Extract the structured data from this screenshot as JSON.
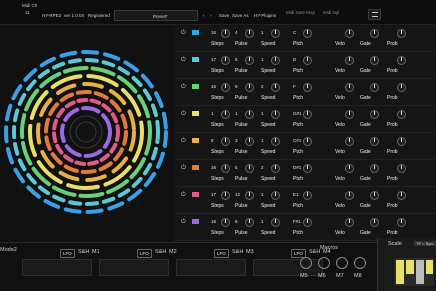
{
  "header": {
    "midi_ch_label": "Midi Ch",
    "midi_ch_value": "11",
    "app_name": "HY-RPE2",
    "version": "ver 1.0.04",
    "registered": "Registered",
    "preset": "Preset*",
    "save": "Save",
    "save_as": "Save As",
    "brand": "HY-Plugins",
    "midi_note_map": "Midi Note Map",
    "midi_ngl": "Midi Ngl",
    "menu_icon": "menu-icon"
  },
  "tracks": [
    {
      "color": "#3aa0e6",
      "steps": "16",
      "pulse": "4",
      "speed": "1",
      "pitch": "C",
      "velo": "",
      "gate": "",
      "prob": ""
    },
    {
      "color": "#5cc8d6",
      "steps": "17",
      "pulse": "8",
      "speed": "1",
      "pitch": "D",
      "velo": "",
      "gate": "",
      "prob": ""
    },
    {
      "color": "#69d07a",
      "steps": "16",
      "pulse": "6",
      "speed": "2",
      "pitch": "F",
      "velo": "",
      "gate": "",
      "prob": ""
    },
    {
      "color": "#e6e06a",
      "steps": "1",
      "pulse": "1",
      "speed": "1",
      "pitch": "G#1",
      "velo": "",
      "gate": "",
      "prob": ""
    },
    {
      "color": "#e6b04a",
      "steps": "8",
      "pulse": "3",
      "speed": "1",
      "pitch": "C#1",
      "velo": "",
      "gate": "",
      "prob": ""
    },
    {
      "color": "#e07a3a",
      "steps": "16",
      "pulse": "5",
      "speed": "2",
      "pitch": "D#1",
      "velo": "",
      "gate": "",
      "prob": ""
    },
    {
      "color": "#e05a8a",
      "steps": "17",
      "pulse": "12",
      "speed": "1",
      "pitch": "E1",
      "velo": "",
      "gate": "",
      "prob": ""
    },
    {
      "color": "#9a6ae6",
      "steps": "16",
      "pulse": "8",
      "speed": "1",
      "pitch": "F#1",
      "velo": "",
      "gate": "",
      "prob": ""
    }
  ],
  "labels": {
    "steps": "Steps",
    "pulse": "Pulse",
    "speed": "Speed",
    "pitch": "Ptch",
    "velo": "Velo",
    "gate": "Gate",
    "prob": "Prob"
  },
  "modulators": [
    {
      "name": "M1",
      "mode": "S&H",
      "lfo": "LFO"
    },
    {
      "name": "M2",
      "mode": "S&H",
      "lfo": "LFO"
    },
    {
      "name": "M3",
      "mode": "S&H",
      "lfo": "LFO"
    },
    {
      "name": "M4",
      "mode": "S&H",
      "lfo": "LFO"
    }
  ],
  "macros": {
    "title": "Macros",
    "labels": [
      "M5",
      "M6",
      "M7",
      "M8"
    ]
  },
  "scale": {
    "title": "Scale",
    "option": "TP = Sym"
  },
  "mode_label": "Mode2",
  "colors": {
    "accent": "#3aa0e6"
  }
}
